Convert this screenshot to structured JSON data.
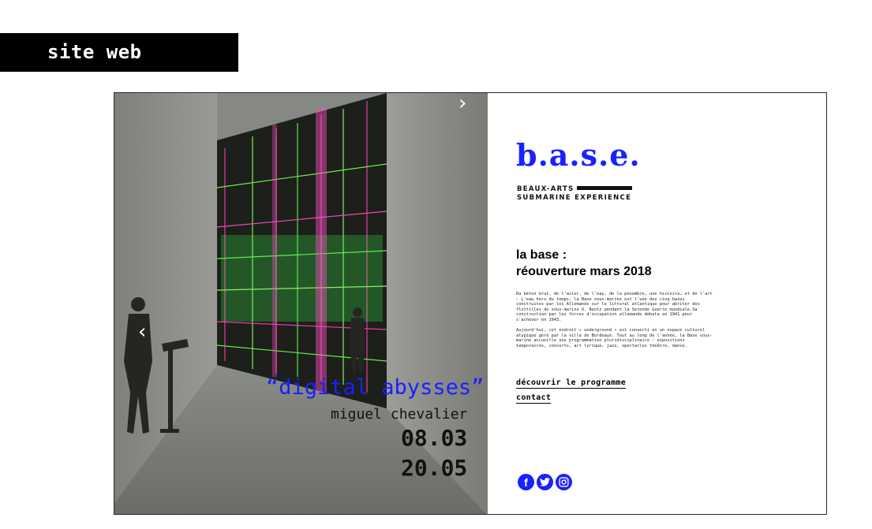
{
  "site_tag": "site web",
  "slider": {
    "prev_icon": "chevron-left-icon",
    "next_icon": "chevron-right-icon",
    "prev_glyph": "‹",
    "next_glyph": "›",
    "caption_title": "“digital abysses”",
    "caption_artist": "miguel chevalier",
    "date_start": "08.03",
    "date_end": "20.05"
  },
  "brand": {
    "logo": "b.a.s.e.",
    "tagline_line1": "BEAUX-ARTS",
    "tagline_line2": "SUBMARINE EXPERIENCE"
  },
  "heading": {
    "line1": "la base :",
    "line2": "réouverture mars 2018"
  },
  "body": {
    "paragraph1": "Du béton brut, de l'acier, de l'eau, de la pénombre, une histoire… et de l'art : L'eau hors du temps, la Base sous-marine est l'une des cinq bases construites par les Allemands sur le littoral atlantique pour abriter des flottilles de sous-marins U. Bootz pendant la Seconde Guerre mondiale.Sa construction par les forces d'occupation allemande débuta en 1941 pour s'achever en 1943.",
    "paragraph2": "Aujourd'hui, cet endroit « underground » est converti en un espace culturel atypique géré par la ville de Bordeaux. Tout au long de l'année, la Base sous-marine accueille une programmation pluridisciplinaire : expositions temporaires, concerts, art lyrique, jazz, spectacles théâtre, danse."
  },
  "links": {
    "programme": "découvrir le programme",
    "contact": "contact"
  },
  "social": {
    "icons": [
      "facebook-icon",
      "twitter-icon",
      "instagram-icon"
    ],
    "facebook_glyph": "f"
  },
  "colors": {
    "accent": "#1a21ff",
    "text": "#000000"
  }
}
